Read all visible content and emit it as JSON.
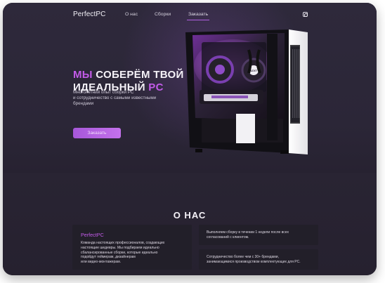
{
  "brand": {
    "name": "PerfectPC"
  },
  "nav": {
    "about": "О нас",
    "builds": "Сборки",
    "order": "Заказать"
  },
  "hero": {
    "title_accent_1": "МЫ",
    "title_text_1": " СОБЕРЁМ ТВОЙ",
    "title_text_2": "ИДЕАЛЬНЫЙ ",
    "title_accent_2": "PC",
    "subtitle": "Многолетний опыт сборки PC\nи сотрудничество с самыми известными\nбрендами",
    "button": "Заказать"
  },
  "pc_case": {
    "brand_badge": "NZXT"
  },
  "about": {
    "title": "О НАС",
    "card": {
      "title": "PerfectPC",
      "text": "Команда настоящих профессионалов, создающих\nнастоящие шедевры. Мы подбираем идеально\nсбалансированные сборки, которые идеально\nподойдут геймерам, дизайнерам\nили видео-монтажерам."
    },
    "facts": [
      {
        "text": "Выполняем сборку в течении 1 недели после всех\nсогласований с клиентом."
      },
      {
        "text": "Сотрудничество более чем с 30+ брендами,\nзанимающимися производством комплектующих для PC."
      }
    ]
  },
  "colors": {
    "accent": "#c35be9",
    "background": "#2a2533",
    "card": "#221f29",
    "text": "#f5f2f8"
  },
  "icons": {
    "social": "instagram-icon"
  }
}
